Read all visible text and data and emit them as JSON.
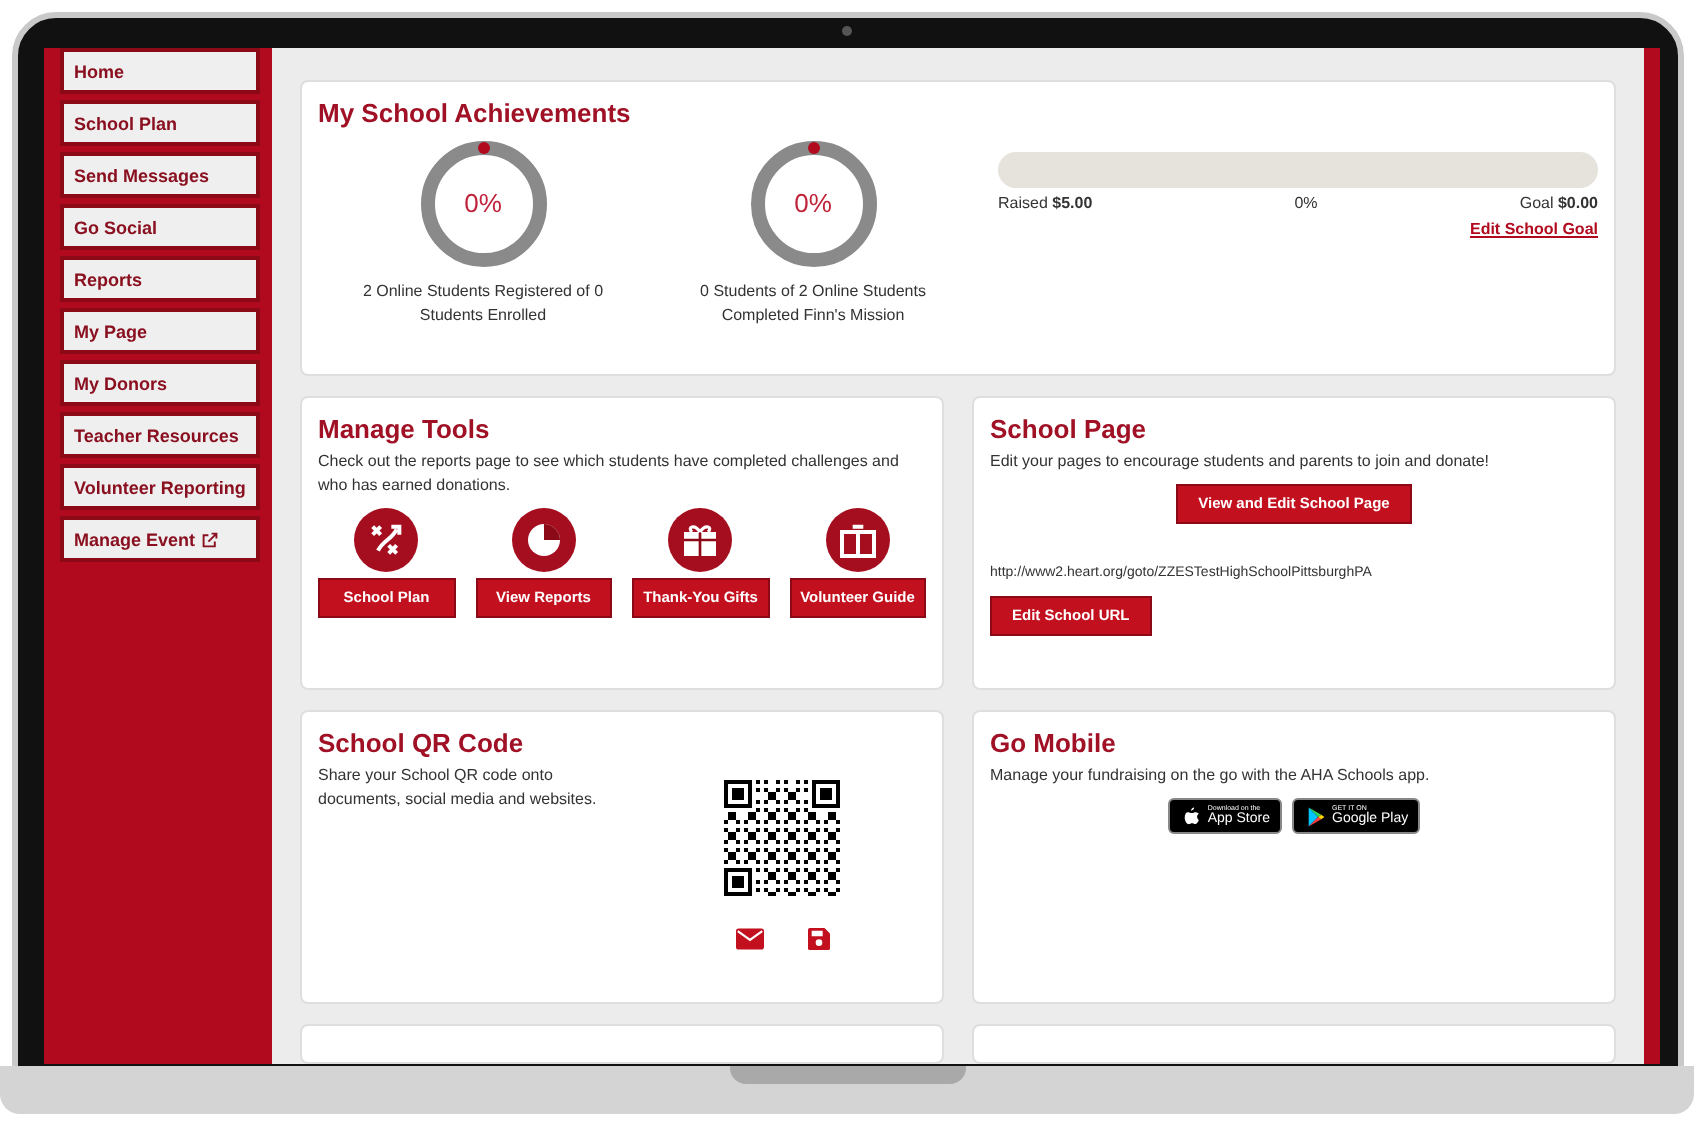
{
  "sidebar": {
    "items": [
      {
        "label": "Home",
        "selected": false,
        "external": false
      },
      {
        "label": "School Plan",
        "selected": false,
        "external": false
      },
      {
        "label": "Send Messages",
        "selected": false,
        "external": false
      },
      {
        "label": "Go Social",
        "selected": false,
        "external": false
      },
      {
        "label": "Reports",
        "selected": false,
        "external": false
      },
      {
        "label": "My Page",
        "selected": false,
        "external": false
      },
      {
        "label": "My Donors",
        "selected": false,
        "external": false
      },
      {
        "label": "Teacher Resources",
        "selected": false,
        "external": false
      },
      {
        "label": "Volunteer Reporting",
        "selected": false,
        "external": false
      },
      {
        "label": "Manage Event",
        "selected": false,
        "external": true
      }
    ]
  },
  "achievements": {
    "title": "My School Achievements",
    "rings": [
      {
        "percent": "0%",
        "caption": "2 Online Students Registered of 0 Students Enrolled"
      },
      {
        "percent": "0%",
        "caption": "0 Students of 2 Online Students Completed Finn's Mission"
      }
    ],
    "goal": {
      "raised_label": "Raised",
      "raised": "$5.00",
      "percent": "0%",
      "goal_label": "Goal",
      "goal": "$0.00",
      "link": "Edit School Goal"
    }
  },
  "manage_tools": {
    "title": "Manage Tools",
    "text": "Check out the reports page to see which students have completed challenges and who has earned donations.",
    "tools": [
      {
        "kind": "plan",
        "label": "School Plan"
      },
      {
        "kind": "reports",
        "label": "View Reports"
      },
      {
        "kind": "gifts",
        "label": "Thank-You Gifts"
      },
      {
        "kind": "guide",
        "label": "Volunteer Guide"
      }
    ]
  },
  "school_page": {
    "title": "School Page",
    "text": "Edit your pages to encourage students and parents to join and donate!",
    "button": "View and Edit School Page",
    "url": "http://www2.heart.org/goto/ZZESTestHighSchoolPittsburghPA",
    "url_button": "Edit School URL"
  },
  "qr": {
    "title": "School QR Code",
    "text": "Share your School QR code onto documents, social media and websites."
  },
  "mobile": {
    "title": "Go Mobile",
    "text": "Manage your fundraising on the go with the AHA Schools app.",
    "badges": [
      {
        "kind": "apple",
        "small": "Download on the",
        "label": "App Store"
      },
      {
        "kind": "google",
        "small": "GET IT ON",
        "label": "Google Play"
      }
    ]
  }
}
